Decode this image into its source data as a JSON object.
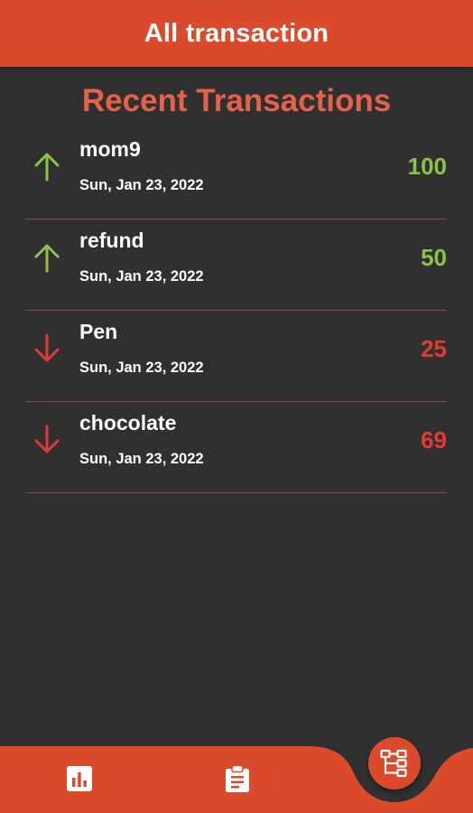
{
  "app_bar": {
    "title": "All transaction"
  },
  "section_title": "Recent Transactions",
  "colors": {
    "accent": "#DB4A2B",
    "income": "#8BC34A",
    "expense": "#E53935",
    "background": "#303030"
  },
  "transactions": [
    {
      "name": "mom9",
      "date": "Sun, Jan 23, 2022",
      "amount": "100",
      "type": "income",
      "icon": "arrow-up-icon"
    },
    {
      "name": "refund",
      "date": "Sun, Jan 23, 2022",
      "amount": "50",
      "type": "income",
      "icon": "arrow-up-icon"
    },
    {
      "name": "Pen",
      "date": "Sun, Jan 23, 2022",
      "amount": "25",
      "type": "expense",
      "icon": "arrow-down-icon"
    },
    {
      "name": "chocolate",
      "date": "Sun, Jan 23, 2022",
      "amount": "69",
      "type": "expense",
      "icon": "arrow-down-icon"
    }
  ],
  "bottom_nav": {
    "items": [
      {
        "icon": "bar-chart-icon"
      },
      {
        "icon": "clipboard-icon"
      }
    ],
    "fab": {
      "icon": "hierarchy-icon"
    }
  }
}
